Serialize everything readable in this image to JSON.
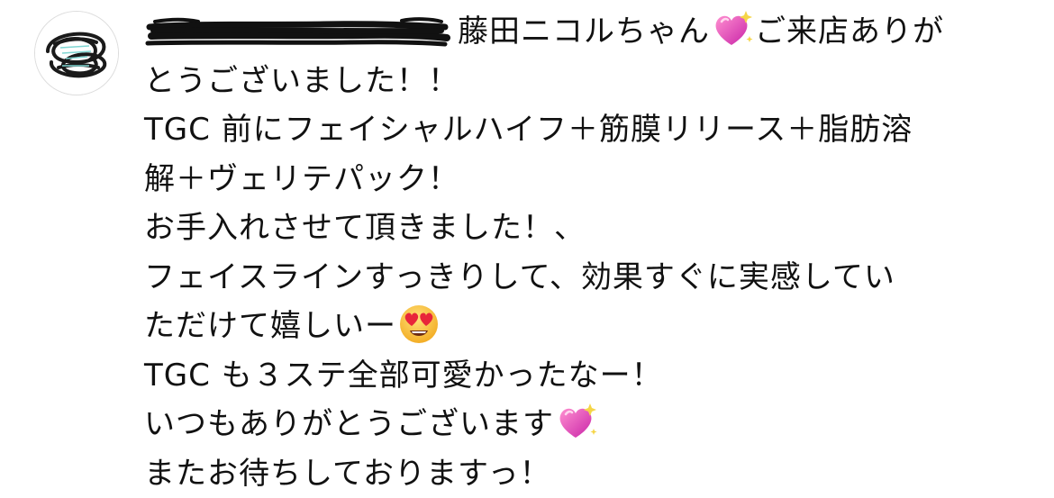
{
  "comment": {
    "username": "",
    "lines": [
      "藤田ニコルちゃん",
      "ご来店ありが",
      "とうございました！！",
      "TGC 前にフェイシャルハイフ＋筋膜リリース＋脂肪溶",
      "解＋ヴェリテパック！",
      "お手入れさせて頂きました！、",
      "フェイスラインすっきりして、効果すぐに実感してい",
      "ただけて嬉しいー",
      "TGC も３ステ全部可愛かったなー！",
      "いつもありがとうございます",
      "またお待ちしておりますっ！"
    ]
  },
  "icons": {
    "heart": "sparkling-heart-icon",
    "face": "heart-eyes-face-icon"
  },
  "colors": {
    "heart": "#f25fb5",
    "face": "#f7c33d",
    "text": "#111111"
  }
}
